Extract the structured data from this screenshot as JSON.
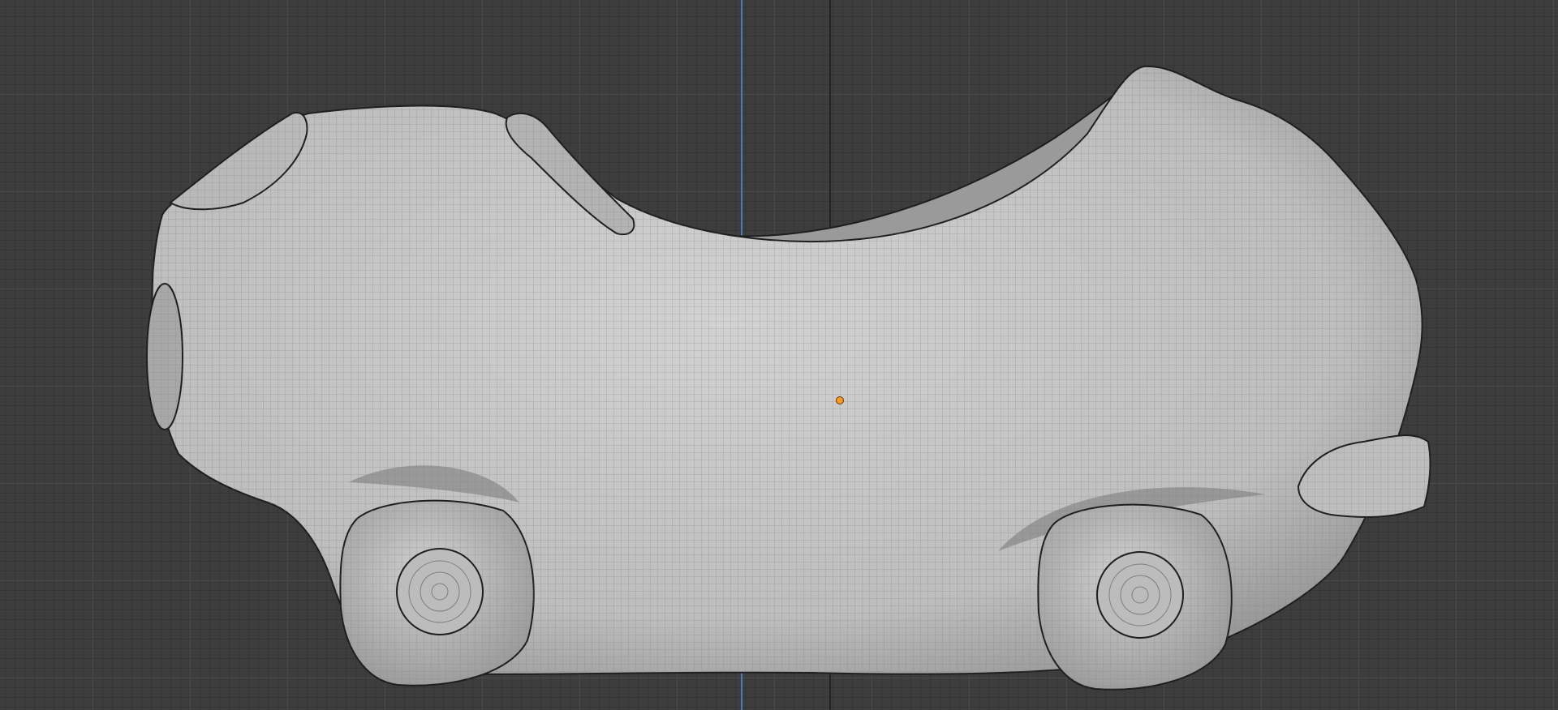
{
  "viewport": {
    "background_color": "#3d3d3d",
    "grid_minor_color": "#353535",
    "grid_major_color": "#4a4a4a",
    "z_axis_color": "#4f78b8",
    "origin_color": "#ff9a1f"
  },
  "mesh": {
    "surface_color": "#c9c9c9",
    "wire_color": "#7d7d7d",
    "edge_color": "#1e1e1e"
  }
}
